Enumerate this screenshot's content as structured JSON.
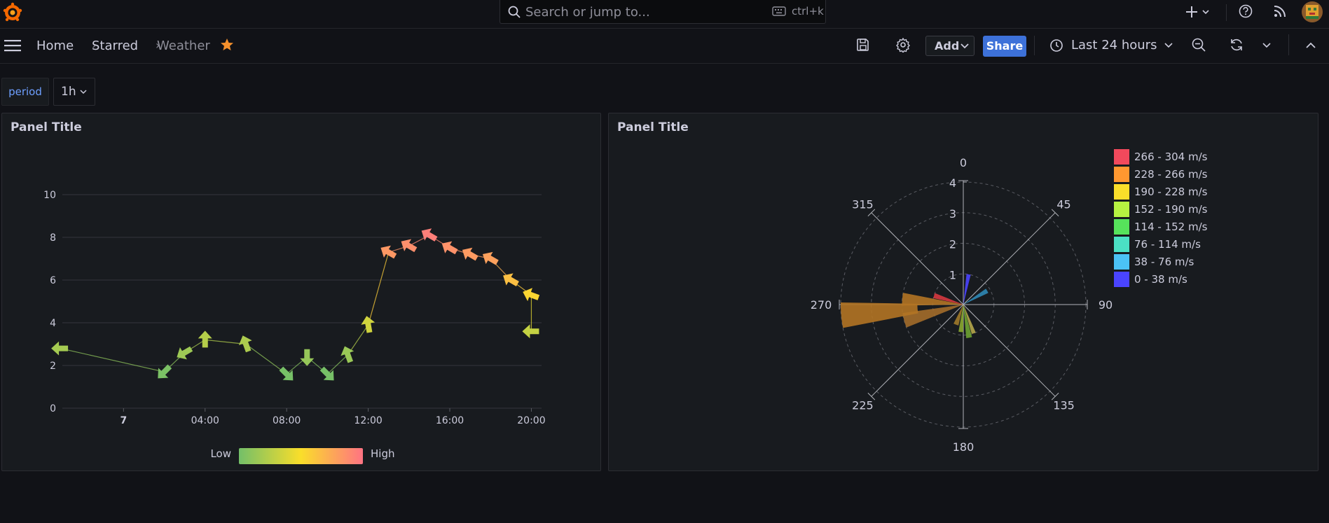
{
  "search": {
    "placeholder": "Search or jump to...",
    "shortcut": "ctrl+k"
  },
  "breadcrumb": {
    "home": "Home",
    "starred": "Starred",
    "current": "Weather"
  },
  "toolbar": {
    "add_label": "Add",
    "share_label": "Share",
    "time_range": "Last 24 hours"
  },
  "variables": {
    "name": "period",
    "value": "1h"
  },
  "panels": [
    {
      "title": "Panel Title"
    },
    {
      "title": "Panel Title"
    }
  ],
  "colors": {
    "accent": "#3d71d9",
    "star": "#f5902c",
    "background": "#111217",
    "panel": "#181b1f"
  },
  "chart_data": [
    {
      "type": "line",
      "x_ticks": [
        "7",
        "04:00",
        "08:00",
        "12:00",
        "16:00",
        "20:00"
      ],
      "y_ticks": [
        "0",
        "2",
        "4",
        "6",
        "8",
        "10"
      ],
      "ylim": [
        0,
        10
      ],
      "x_range_hours": [
        -3,
        20.5
      ],
      "series": [
        {
          "points": [
            {
              "x": -3.1,
              "y": 2.8,
              "dir": 270
            },
            {
              "x": 2.0,
              "y": 1.7,
              "dir": 225
            },
            {
              "x": 3.0,
              "y": 2.6,
              "dir": 240
            },
            {
              "x": 4.0,
              "y": 3.2,
              "dir": 0
            },
            {
              "x": 6.0,
              "y": 3.0,
              "dir": 340
            },
            {
              "x": 8.0,
              "y": 1.6,
              "dir": 135
            },
            {
              "x": 9.0,
              "y": 2.4,
              "dir": 180
            },
            {
              "x": 10.0,
              "y": 1.6,
              "dir": 135
            },
            {
              "x": 11.0,
              "y": 2.5,
              "dir": 340
            },
            {
              "x": 12.0,
              "y": 3.9,
              "dir": 350
            },
            {
              "x": 13.0,
              "y": 7.3,
              "dir": 300
            },
            {
              "x": 14.0,
              "y": 7.6,
              "dir": 300
            },
            {
              "x": 15.0,
              "y": 8.1,
              "dir": 300
            },
            {
              "x": 16.0,
              "y": 7.5,
              "dir": 300
            },
            {
              "x": 17.0,
              "y": 7.2,
              "dir": 300
            },
            {
              "x": 18.0,
              "y": 7.0,
              "dir": 300
            },
            {
              "x": 19.0,
              "y": 6.0,
              "dir": 300
            },
            {
              "x": 20.0,
              "y": 5.3,
              "dir": 290
            },
            {
              "x": 20.0,
              "y": 3.6,
              "dir": 270
            }
          ]
        }
      ],
      "gradient_legend": {
        "low": "Low",
        "high": "High",
        "colors": [
          "#73bf69",
          "#fade2a",
          "#ff7383"
        ]
      }
    },
    {
      "type": "polar-bar",
      "angle_ticks": [
        "0",
        "45",
        "90",
        "135",
        "180",
        "225",
        "270",
        "315"
      ],
      "radial_ticks": [
        "1",
        "2",
        "3",
        "4"
      ],
      "rmax": 4,
      "legend": [
        {
          "label": "266 - 304 m/s",
          "color": "#f2495c"
        },
        {
          "label": "228 - 266 m/s",
          "color": "#ff9830"
        },
        {
          "label": "190 - 228 m/s",
          "color": "#fade2a"
        },
        {
          "label": "152 - 190 m/s",
          "color": "#b6f241"
        },
        {
          "label": "114 - 152 m/s",
          "color": "#56e35b"
        },
        {
          "label": "76 - 114 m/s",
          "color": "#4be0c4"
        },
        {
          "label": "38 - 76 m/s",
          "color": "#4bc2f5"
        },
        {
          "label": "0 - 38 m/s",
          "color": "#4a44ff"
        }
      ],
      "wedges": [
        {
          "angle": 10,
          "width": 8,
          "r0": 0,
          "r1": 1.0,
          "color": "#4a44ff"
        },
        {
          "angle": 60,
          "width": 10,
          "r0": 0,
          "r1": 0.9,
          "color": "#2f88b5"
        },
        {
          "angle": 160,
          "width": 8,
          "r0": 0,
          "r1": 1.0,
          "color": "#b6a84a"
        },
        {
          "angle": 170,
          "width": 10,
          "r0": 0,
          "r1": 1.1,
          "color": "#6ea332"
        },
        {
          "angle": 185,
          "width": 10,
          "r0": 0,
          "r1": 0.9,
          "color": "#8aa830"
        },
        {
          "angle": 200,
          "width": 14,
          "r0": 0,
          "r1": 0.7,
          "color": "#a07a2a"
        },
        {
          "angle": 255,
          "width": 14,
          "r0": 0,
          "r1": 2.0,
          "color": "#a36d2a"
        },
        {
          "angle": 265,
          "width": 12,
          "r0": 1.5,
          "r1": 4.0,
          "color": "#b37424"
        },
        {
          "angle": 275,
          "width": 12,
          "r0": 0,
          "r1": 2.0,
          "color": "#b37424"
        },
        {
          "angle": 287,
          "width": 10,
          "r0": 0,
          "r1": 1.0,
          "color": "#d6383f"
        }
      ]
    }
  ]
}
